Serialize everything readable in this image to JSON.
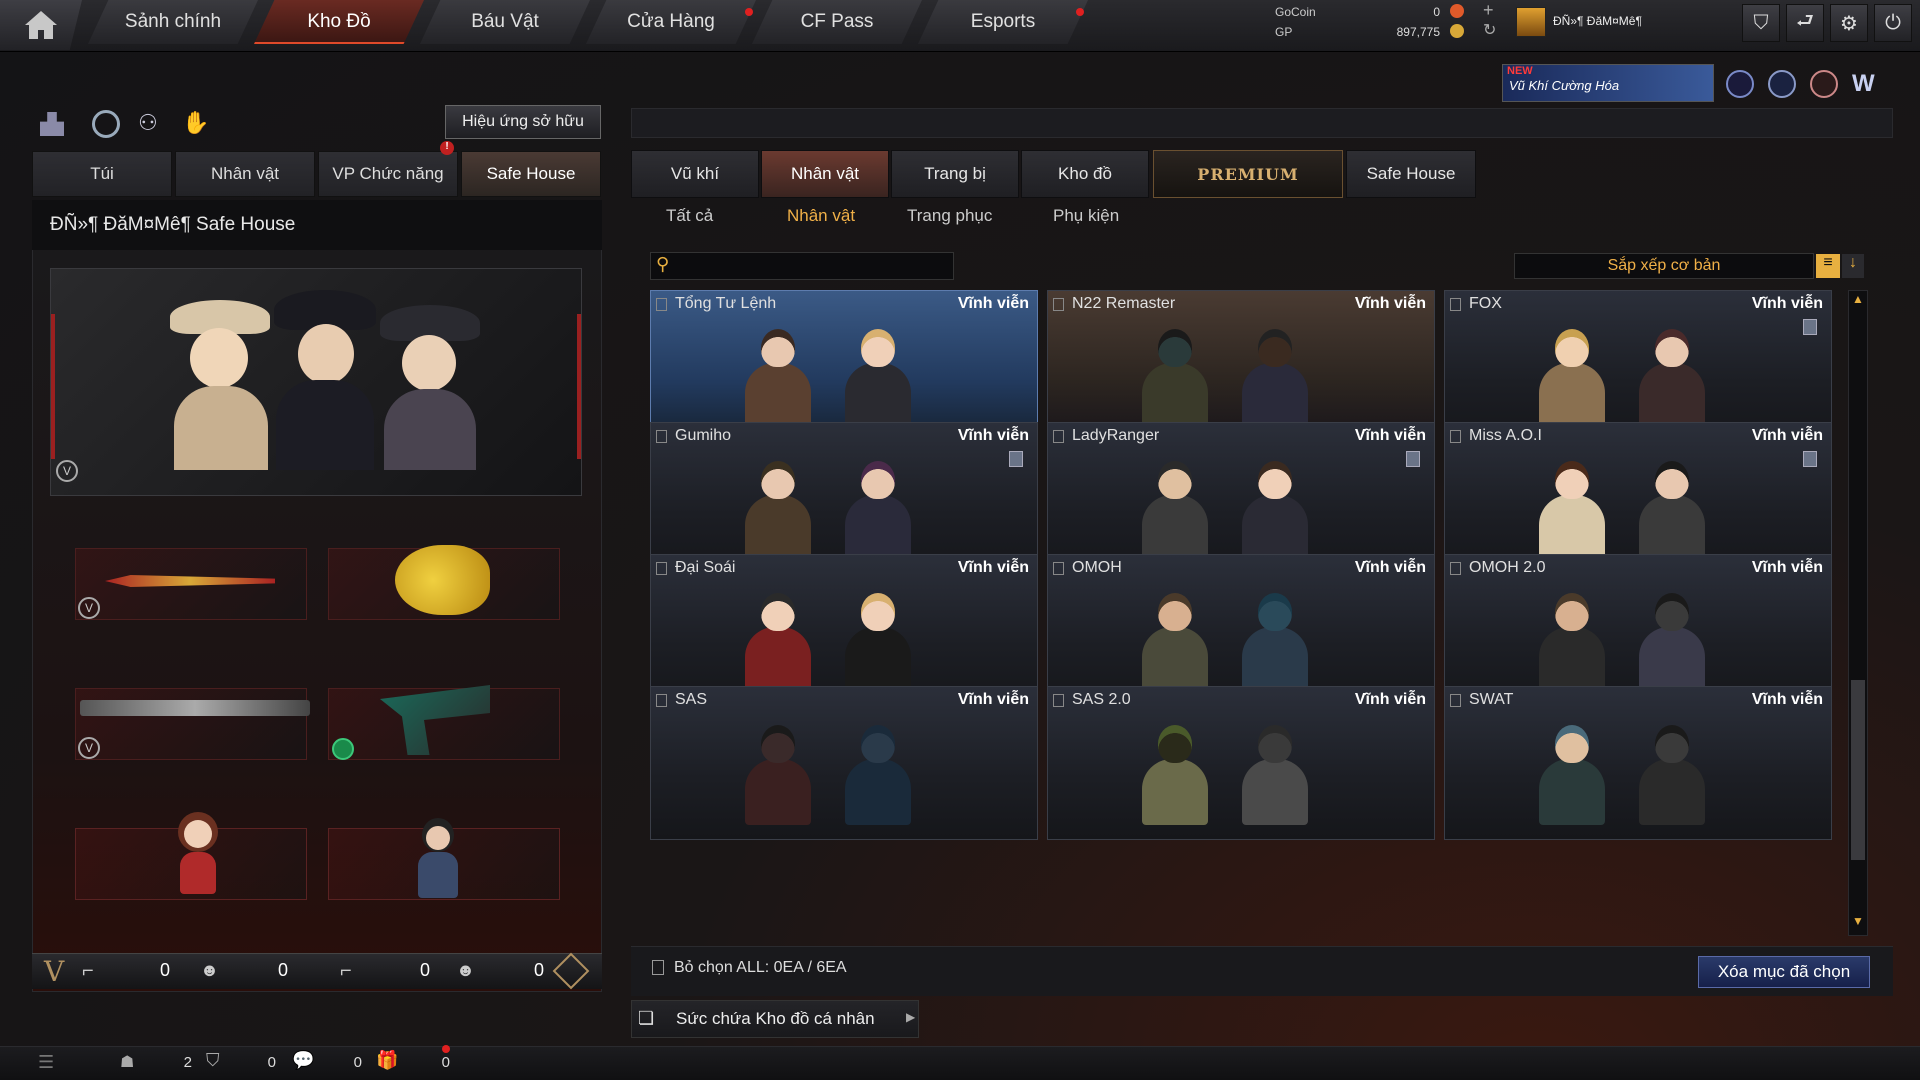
{
  "topnav": {
    "tabs": [
      "Sảnh chính",
      "Kho Đồ",
      "Báu Vật",
      "Cửa Hàng",
      "CF Pass",
      "Esports"
    ],
    "active": "Kho Đồ"
  },
  "currency": {
    "gocoin_label": "GoCoin",
    "gocoin_value": "0",
    "gp_label": "GP",
    "gp_value": "897,775"
  },
  "player": {
    "name": "ĐÑ»¶ ĐăM¤Mê¶"
  },
  "banner": {
    "badge": "NEW",
    "text": "Vũ Khí Cường Hóa"
  },
  "left_panel": {
    "effect_button": "Hiệu ứng sở hữu",
    "tabs": [
      "Túi",
      "Nhân vật",
      "VP Chức năng",
      "Safe House"
    ],
    "active_tab": "Safe House",
    "title": "ĐÑ»¶ ĐăM¤Mê¶  Safe House",
    "counters": [
      "0",
      "0",
      "0",
      "0"
    ]
  },
  "right_panel": {
    "tabs": [
      "Vũ khí",
      "Nhân vật",
      "Trang bị",
      "Kho đồ",
      "PREMIUM",
      "Safe House"
    ],
    "active_tab": "Nhân vật",
    "subtabs": [
      "Tất cả",
      "Nhân vật",
      "Trang phục",
      "Phụ kiện"
    ],
    "active_subtab": "Nhân vật",
    "search_placeholder": "",
    "sort_label": "Sắp xếp cơ bản",
    "items": [
      {
        "name": "Tổng Tư Lệnh",
        "duration": "Vĩnh viễn"
      },
      {
        "name": "N22 Remaster",
        "duration": "Vĩnh viễn"
      },
      {
        "name": "FOX",
        "duration": "Vĩnh viễn"
      },
      {
        "name": "Gumiho",
        "duration": "Vĩnh viễn"
      },
      {
        "name": "LadyRanger",
        "duration": "Vĩnh viễn"
      },
      {
        "name": "Miss A.O.I",
        "duration": "Vĩnh viễn"
      },
      {
        "name": "Đại Soái",
        "duration": "Vĩnh viễn"
      },
      {
        "name": "OMOH",
        "duration": "Vĩnh viễn"
      },
      {
        "name": "OMOH 2.0",
        "duration": "Vĩnh viễn"
      },
      {
        "name": "SAS",
        "duration": "Vĩnh viễn"
      },
      {
        "name": "SAS 2.0",
        "duration": "Vĩnh viễn"
      },
      {
        "name": "SWAT",
        "duration": "Vĩnh viễn"
      }
    ],
    "deselect_label": "Bỏ chọn ALL: 0EA / 6EA",
    "delete_button": "Xóa mục đã chọn",
    "capacity_label": "Sức chứa Kho đồ cá nhân"
  },
  "statusbar": {
    "values": [
      "2",
      "0",
      "0",
      "0"
    ]
  },
  "colors": {
    "accent": "#e04a2a",
    "gold": "#f0b048",
    "selected_card": "#3b5a86"
  }
}
